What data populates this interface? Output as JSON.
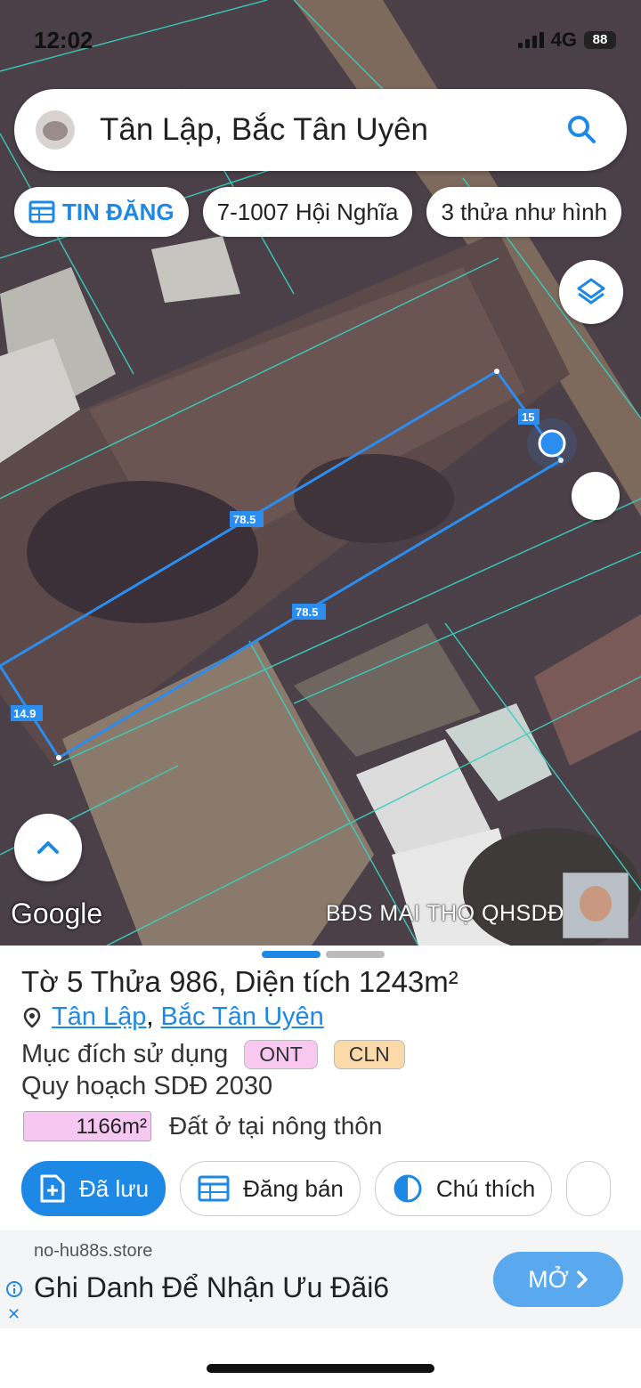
{
  "status_bar": {
    "time": "12:02",
    "network": "4G",
    "battery": "88"
  },
  "search": {
    "text": "Tân Lập, Bắc Tân Uyên"
  },
  "chips": [
    {
      "label": "TIN ĐĂNG",
      "icon": "table-icon"
    },
    {
      "label": "7-1007 Hội Nghĩa"
    },
    {
      "label": "3 thửa như hình"
    }
  ],
  "map": {
    "edge_labels": [
      "15",
      "78.5",
      "78.5",
      "14.9"
    ],
    "attribution": "Google",
    "watermark": "BĐS MAI THỌ QHSDĐ 2030"
  },
  "parcel": {
    "title_prefix": "Tờ",
    "sheet": "5",
    "parcel_word": "Thửa",
    "parcel_no": "986",
    "area_word": ", Diện tích",
    "area": "1243m²",
    "location_1": "Tân Lập",
    "location_sep": ",",
    "location_2": "Bắc Tân Uyên",
    "purpose_label": "Mục đích sử dụng",
    "purpose_tags": [
      "ONT",
      "CLN"
    ],
    "plan_label": "Quy hoạch SDĐ 2030",
    "plan_area": "1166m²",
    "plan_desc": "Đất ở tại nông thôn"
  },
  "actions": [
    {
      "label": "Đã lưu",
      "icon": "add-file-icon"
    },
    {
      "label": "Đăng bán",
      "icon": "table-icon"
    },
    {
      "label": "Chú thích",
      "icon": "half-circle-icon"
    }
  ],
  "ad": {
    "domain": "no-hu88s.store",
    "title": "Ghi Danh Để Nhận Ưu Đãi6",
    "button": "MỞ"
  },
  "colors": {
    "accent": "#1e88e5",
    "ont_tag": "#f8c8f0",
    "cln_tag": "#fbd9a8"
  }
}
